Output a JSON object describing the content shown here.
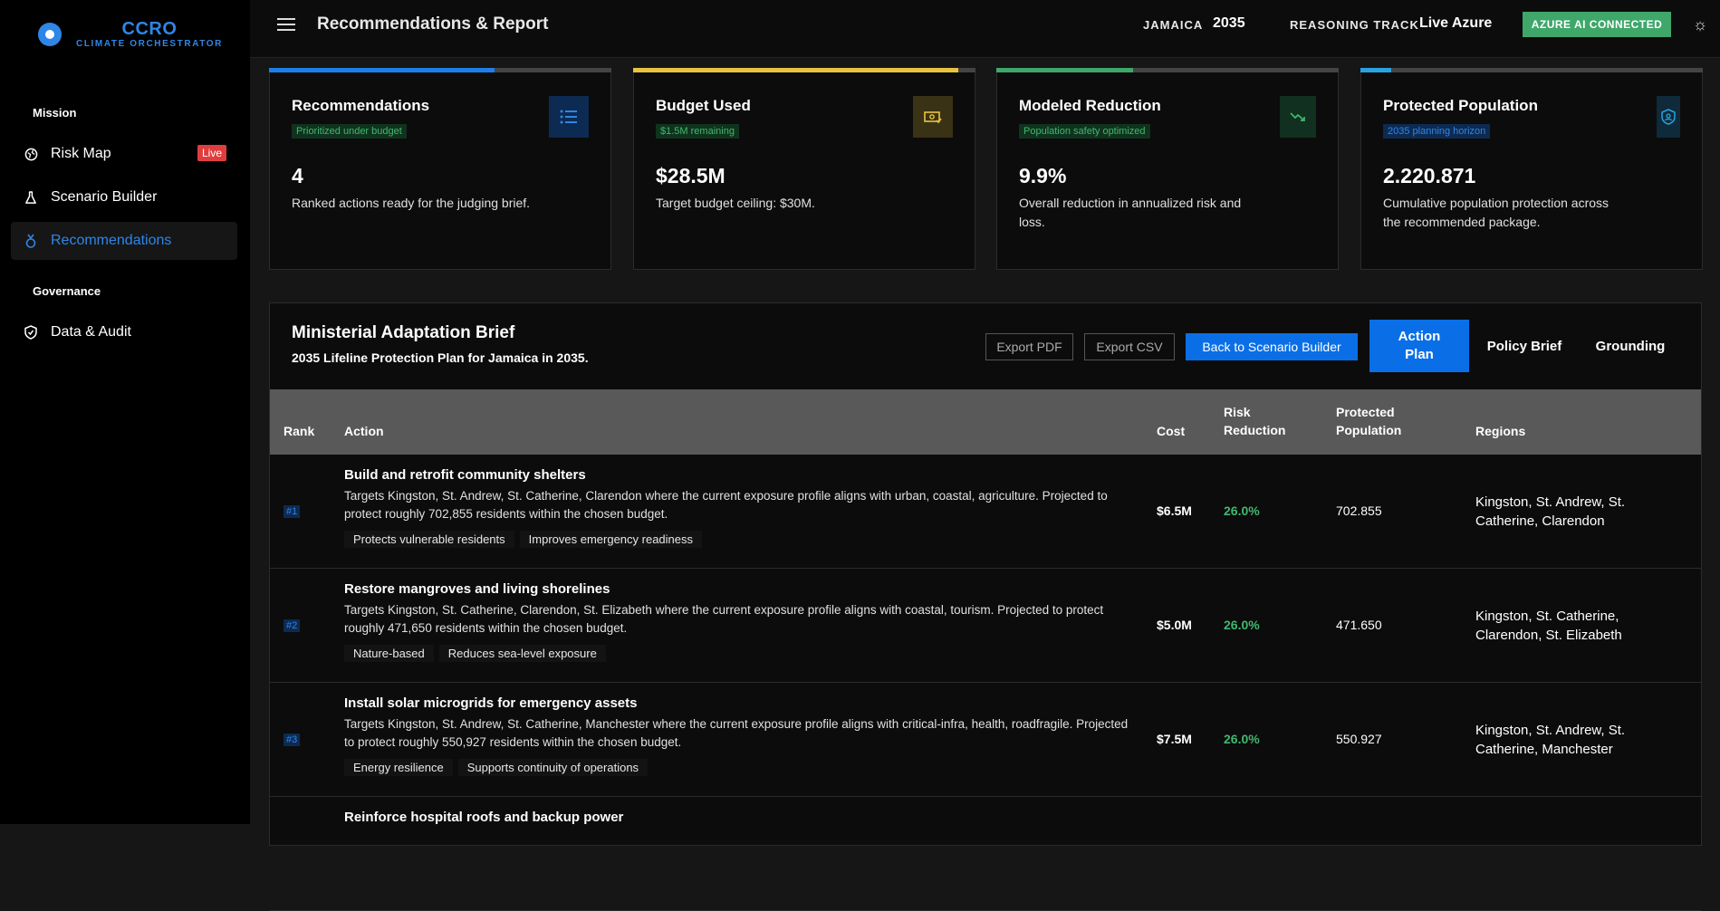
{
  "app": {
    "logo_title": "CCRO",
    "logo_subtitle": "CLIMATE ORCHESTRATOR"
  },
  "sidebar": {
    "sections": [
      {
        "label": "Mission"
      },
      {
        "label": "Governance"
      }
    ],
    "items": [
      {
        "label": "Risk Map",
        "icon": "globe-icon",
        "badge": "Live"
      },
      {
        "label": "Scenario Builder",
        "icon": "flask-icon"
      },
      {
        "label": "Recommendations",
        "icon": "medal-icon",
        "active": true
      },
      {
        "label": "Data & Audit",
        "icon": "shield-check-icon"
      }
    ]
  },
  "header": {
    "title": "Recommendations & Report",
    "country_label": "JAMAICA",
    "year": "2035",
    "track_label": "REASONING TRACK",
    "track_value": "Live Azure",
    "status_button": "AZURE AI CONNECTED"
  },
  "cards": [
    {
      "title": "Recommendations",
      "badge": "Prioritized under budget",
      "value": "4",
      "desc": "Ranked actions ready for the judging brief.",
      "icon": "list-icon",
      "progress": 0.66,
      "accent": "#1f7fe8",
      "badge_color": "#3fb96e",
      "badge_bg": "#10331e"
    },
    {
      "title": "Budget Used",
      "badge": "$1.5M remaining",
      "value": "$28.5M",
      "desc": "Target budget ceiling: $30M.",
      "icon": "money-icon",
      "progress": 0.95,
      "accent": "#e8c341",
      "badge_color": "#3fb96e",
      "badge_bg": "#10331e"
    },
    {
      "title": "Modeled Reduction",
      "badge": "Population safety optimized",
      "value": "9.9%",
      "desc": "Overall reduction in annualized risk and loss.",
      "icon": "trend-down-icon",
      "progress": 0.4,
      "accent": "#3fa76a",
      "badge_color": "#3fb96e",
      "badge_bg": "#10331e"
    },
    {
      "title": "Protected Population",
      "badge": "2035 planning horizon",
      "value": "2.220.871",
      "desc": "Cumulative population protection across the recommended package.",
      "icon": "shield-user-icon",
      "progress": 0.09,
      "accent": "#29a3e0",
      "badge_color": "#2f86e6",
      "badge_bg": "#0d2a52"
    }
  ],
  "brief": {
    "title": "Ministerial Adaptation Brief",
    "subtitle": "2035 Lifeline Protection Plan for Jamaica in 2035.",
    "export_pdf": "Export PDF",
    "export_csv": "Export CSV",
    "back_button": "Back to Scenario Builder",
    "tabs": [
      "Action Plan",
      "Policy Brief",
      "Grounding"
    ],
    "columns": [
      "Rank",
      "Action",
      "Cost",
      "Risk Reduction",
      "Protected Population",
      "Regions"
    ],
    "rows": [
      {
        "rank": "#1",
        "title": "Build and retrofit community shelters",
        "desc": "Targets Kingston, St. Andrew, St. Catherine, Clarendon where the current exposure profile aligns with urban, coastal, agriculture. Projected to protect roughly 702,855 residents within the chosen budget.",
        "tags": [
          "Protects vulnerable residents",
          "Improves emergency readiness"
        ],
        "cost": "$6.5M",
        "risk": "26.0%",
        "population": "702.855",
        "regions": "Kingston, St. Andrew, St. Catherine, Clarendon"
      },
      {
        "rank": "#2",
        "title": "Restore mangroves and living shorelines",
        "desc": "Targets Kingston, St. Catherine, Clarendon, St. Elizabeth where the current exposure profile aligns with coastal, tourism. Projected to protect roughly 471,650 residents within the chosen budget.",
        "tags": [
          "Nature-based",
          "Reduces sea-level exposure"
        ],
        "cost": "$5.0M",
        "risk": "26.0%",
        "population": "471.650",
        "regions": "Kingston, St. Catherine, Clarendon, St. Elizabeth"
      },
      {
        "rank": "#3",
        "title": "Install solar microgrids for emergency assets",
        "desc": "Targets Kingston, St. Andrew, St. Catherine, Manchester where the current exposure profile aligns with critical-infra, health, roadfragile. Projected to protect roughly 550,927 residents within the chosen budget.",
        "tags": [
          "Energy resilience",
          "Supports continuity of operations"
        ],
        "cost": "$7.5M",
        "risk": "26.0%",
        "population": "550.927",
        "regions": "Kingston, St. Andrew, St. Catherine, Manchester"
      },
      {
        "title": "Reinforce hospital roofs and backup power"
      }
    ]
  }
}
